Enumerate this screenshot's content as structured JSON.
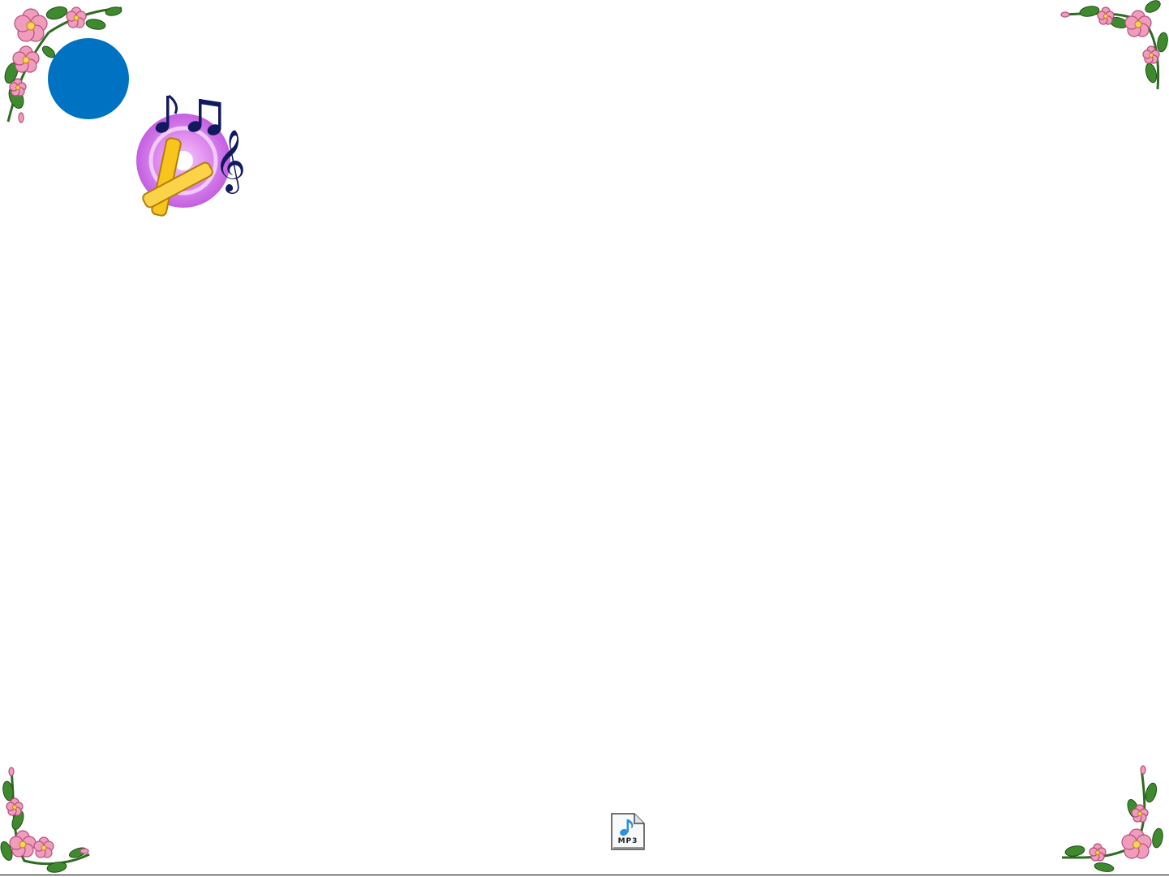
{
  "slide": {
    "background": "#ffffff",
    "accent_circle_color": "#0072c2"
  },
  "decorations": {
    "corner_icon": "pink-flower-vine-icon",
    "flower_color": "#e98bb1",
    "leaf_color": "#3f8a2e"
  },
  "clipart": {
    "icon": "music-notes-cd-icon",
    "disc_color": "#d277e8",
    "note_color": "#1a1a6e",
    "sticks_color": "#f5c21b"
  },
  "audio": {
    "icon": "mp3-file-icon",
    "label": "MP3"
  }
}
